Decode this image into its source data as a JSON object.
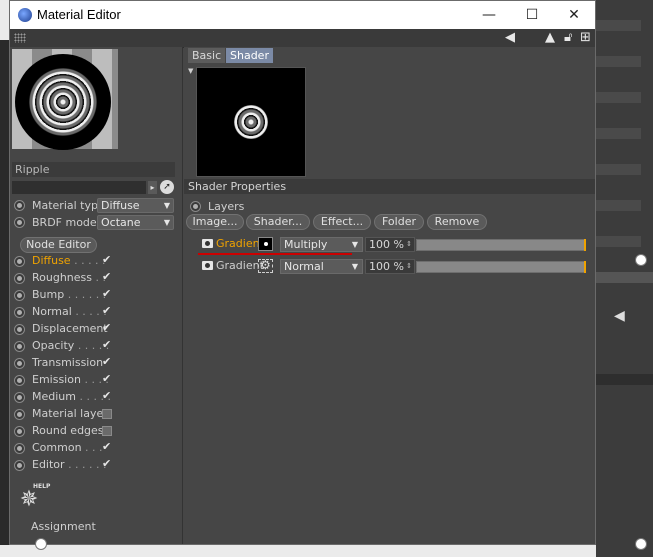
{
  "window": {
    "title": "Material Editor"
  },
  "window_controls": {
    "minimize": "—",
    "maximize": "☐",
    "close": "✕"
  },
  "material": {
    "name": "Ripple"
  },
  "properties": [
    {
      "label": "Material type",
      "value": "Diffuse"
    },
    {
      "label": "BRDF model",
      "value": "Octane"
    }
  ],
  "node_editor_label": "Node Editor",
  "channels": [
    {
      "label": "Diffuse",
      "dots": ". . . . .",
      "state": "checked",
      "active": true
    },
    {
      "label": "Roughness",
      "dots": ". .",
      "state": "checked",
      "active": false
    },
    {
      "label": "Bump",
      "dots": ". . . . . .",
      "state": "checked",
      "active": false
    },
    {
      "label": "Normal",
      "dots": ". . . . .",
      "state": "checked",
      "active": false
    },
    {
      "label": "Displacement",
      "dots": "",
      "state": "checked",
      "active": false
    },
    {
      "label": "Opacity",
      "dots": ". . . . .",
      "state": "checked",
      "active": false
    },
    {
      "label": "Transmission",
      "dots": "",
      "state": "checked",
      "active": false
    },
    {
      "label": "Emission",
      "dots": ". . . .",
      "state": "checked",
      "active": false
    },
    {
      "label": "Medium",
      "dots": ". . . . .",
      "state": "checked",
      "active": false
    },
    {
      "label": "Material layer",
      "dots": "",
      "state": "unchecked",
      "active": false
    },
    {
      "label": "Round edges",
      "dots": "",
      "state": "unchecked",
      "active": false
    },
    {
      "label": "Common",
      "dots": ". . .",
      "state": "checked",
      "active": false
    },
    {
      "label": "Editor",
      "dots": ". . . . . .",
      "state": "checked",
      "active": false
    }
  ],
  "help": {
    "label": "HELP"
  },
  "assignment_label": "Assignment",
  "tabs": [
    {
      "label": "Basic",
      "selected": false
    },
    {
      "label": "Shader",
      "selected": true
    }
  ],
  "shader_properties": {
    "header": "Shader Properties",
    "layers_label": "Layers",
    "buttons": [
      "Image...",
      "Shader...",
      "Effect...",
      "Folder",
      "Remove"
    ],
    "layers": [
      {
        "name": "Gradient",
        "blend": "Multiply",
        "opacity": "100 %",
        "fill": 1.0,
        "active": true
      },
      {
        "name": "Gradient",
        "blend": "Normal",
        "opacity": "100 %",
        "fill": 1.0,
        "active": false
      }
    ]
  },
  "colors": {
    "accent": "#f0a300",
    "panel": "#464646",
    "highlight_underline": "#cc0000",
    "tab_selected": "#7b8aa6"
  }
}
